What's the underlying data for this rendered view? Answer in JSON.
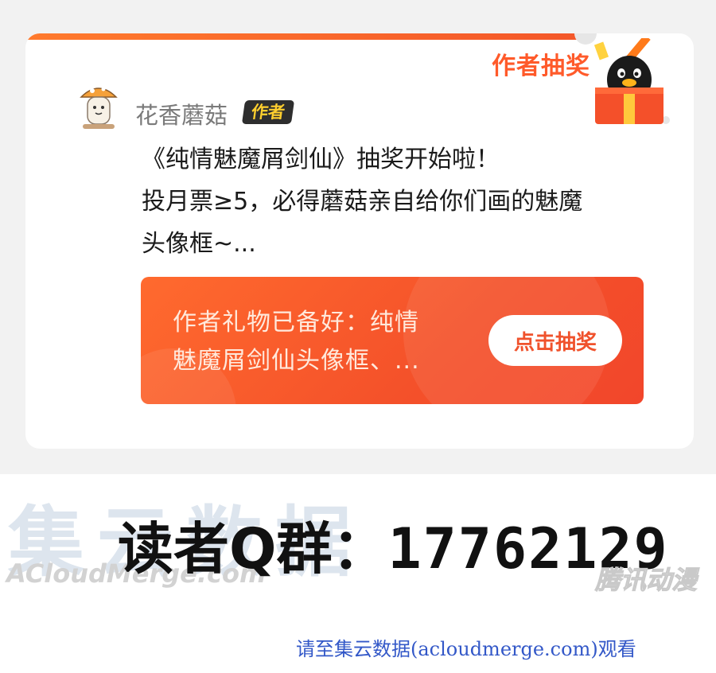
{
  "card": {
    "header_title": "作者抽奖",
    "author": {
      "name": "花香蘑菇",
      "badge": "作者"
    },
    "post_lines": [
      "《纯情魅魔屑剑仙》抽奖开始啦！",
      "投月票≥5，必得蘑菇亲自给你们画的魅魔",
      "头像框~..."
    ],
    "banner": {
      "lines": [
        "作者礼物已备好：纯情",
        "魅魔屑剑仙头像框、..."
      ],
      "button_label": "点击抽奖"
    }
  },
  "footer": {
    "watermark_cn": "集云数据",
    "watermark_en": "ACloudMerge.com",
    "qq_label": "读者Q群：",
    "qq_number": "17762129",
    "platform_logo": "腾讯动漫",
    "source_note": "请至集云数据(acloudmerge.com)观看"
  },
  "colors": {
    "accent": "#f4572a",
    "badge_bg": "#2e2e2e",
    "badge_text": "#ffcf2e",
    "note_blue": "#3358c8"
  },
  "icons": [
    "gift-penguin-icon",
    "mushroom-avatar-icon"
  ]
}
